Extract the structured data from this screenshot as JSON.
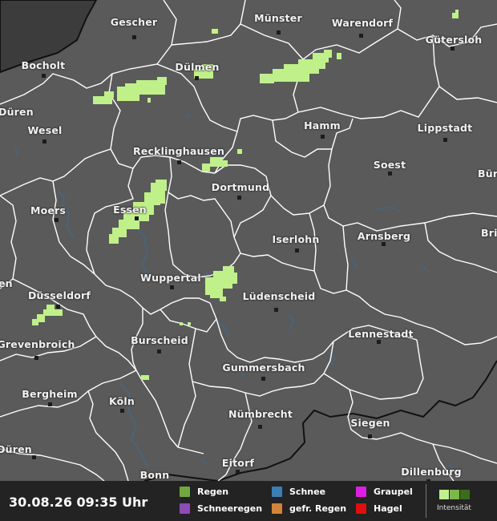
{
  "timestamp": "30.08.26 09:35 Uhr",
  "colors": {
    "land": "#5a5a5a",
    "outside_area": "#3c3c3c",
    "border": "#ffffff",
    "country_border": "#111111",
    "water": "#4a6478",
    "rain_light": "#c0f08a",
    "legend_bg": "#232323"
  },
  "cities": [
    {
      "name": "Gescher"
    },
    {
      "name": "Münster"
    },
    {
      "name": "Warendorf"
    },
    {
      "name": "Gütersloh"
    },
    {
      "name": "Bocholt"
    },
    {
      "name": "Dülmen"
    },
    {
      "name": "Düren"
    },
    {
      "name": "Wesel"
    },
    {
      "name": "Hamm"
    },
    {
      "name": "Lippstadt"
    },
    {
      "name": "Recklinghausen"
    },
    {
      "name": "Soest"
    },
    {
      "name": "Dortmund"
    },
    {
      "name": "Bür"
    },
    {
      "name": "Moers"
    },
    {
      "name": "Essen"
    },
    {
      "name": "Iserlohn"
    },
    {
      "name": "Arnsberg"
    },
    {
      "name": "Bri"
    },
    {
      "name": "Wuppertal"
    },
    {
      "name": "en"
    },
    {
      "name": "Düsseldorf"
    },
    {
      "name": "Lüdenscheid"
    },
    {
      "name": "Lennestadt"
    },
    {
      "name": "Grevenbroich"
    },
    {
      "name": "Burscheid"
    },
    {
      "name": "Gummersbach"
    },
    {
      "name": "Bergheim"
    },
    {
      "name": "Köln"
    },
    {
      "name": "Nümbrecht"
    },
    {
      "name": "Siegen"
    },
    {
      "name": "Düren"
    },
    {
      "name": "Eitorf"
    },
    {
      "name": "Dillenburg"
    },
    {
      "name": "Bonn"
    }
  ],
  "legend": {
    "items": [
      {
        "label": "Regen",
        "color": "#72a83a"
      },
      {
        "label": "Schneeregen",
        "color": "#8e4cb4"
      },
      {
        "label": "Schnee",
        "color": "#3a7fb4"
      },
      {
        "label": "gefr. Regen",
        "color": "#d2843a"
      },
      {
        "label": "Graupel",
        "color": "#e01ee0"
      },
      {
        "label": "Hagel",
        "color": "#dc1010"
      }
    ],
    "intensity_label": "Intensität",
    "intensity_colors": [
      "#c0f08a",
      "#7ab848",
      "#3a6e1a"
    ]
  }
}
